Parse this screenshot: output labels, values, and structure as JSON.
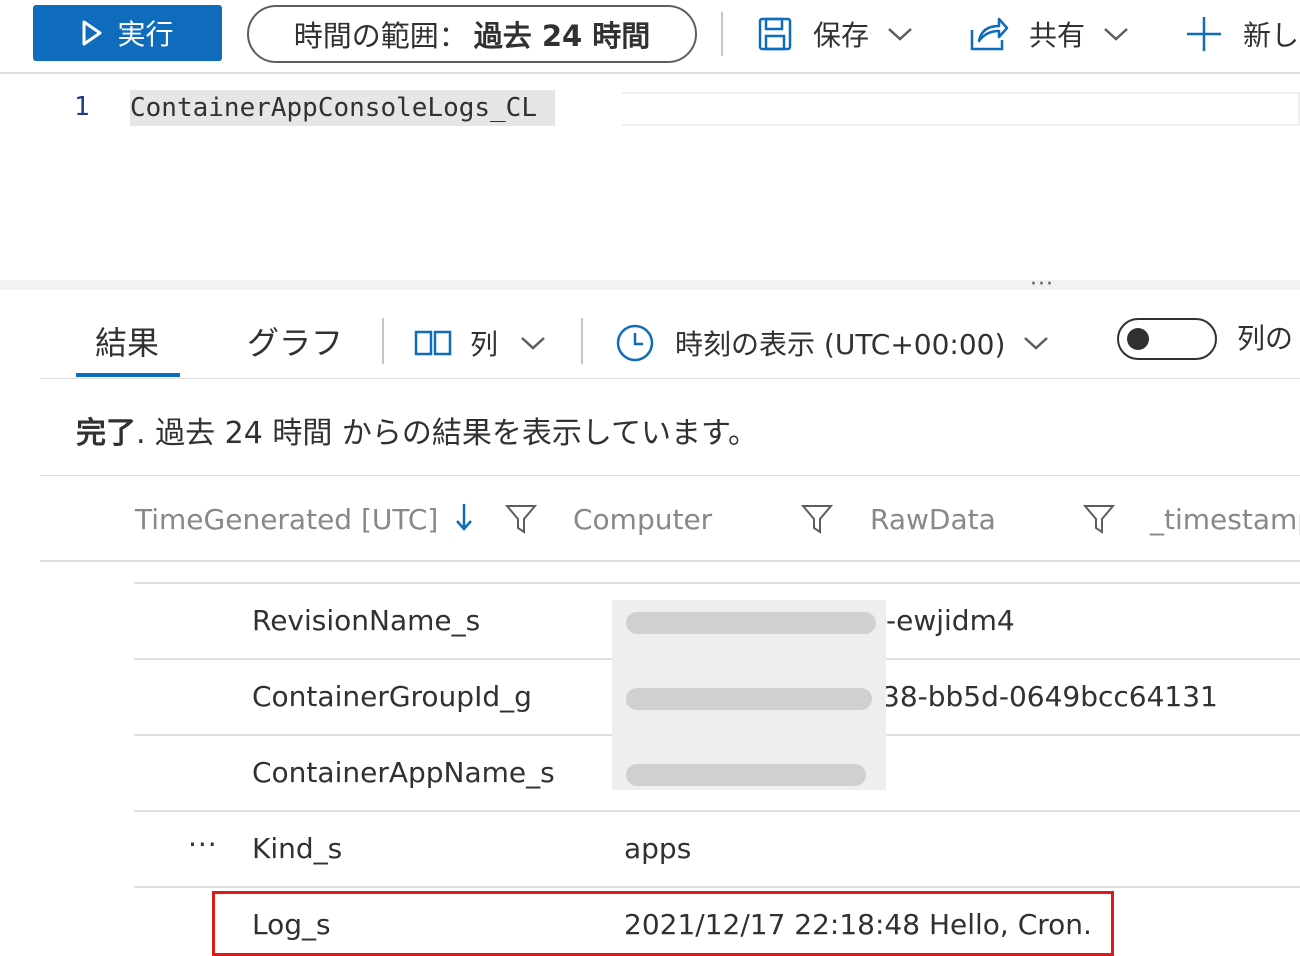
{
  "toolbar": {
    "run_label": "実行",
    "time_range_prefix": "時間の範囲：",
    "time_range_value": "過去 24 時間",
    "save_label": "保存",
    "share_label": "共有",
    "new_label": "新し"
  },
  "editor": {
    "line_number": "1",
    "query": "ContainerAppConsoleLogs_CL"
  },
  "results": {
    "tabs": [
      {
        "label": "結果",
        "active": true
      },
      {
        "label": "グラフ",
        "active": false
      }
    ],
    "columns_label": "列",
    "time_display_label": "時刻の表示 (UTC+00:00)",
    "toggle_label": "列の",
    "status_bold": "完了",
    "status_text": ". 過去 24 時間 からの結果を表示しています。",
    "headers": [
      "TimeGenerated [UTC]",
      "Computer",
      "RawData",
      "_timestamp"
    ]
  },
  "details": [
    {
      "key": "RevisionName_s",
      "value": "-ewjidm4",
      "redacted": true
    },
    {
      "key": "ContainerGroupId_g",
      "value": "38-bb5d-0649bcc64131",
      "redacted": true
    },
    {
      "key": "ContainerAppName_s",
      "value": "",
      "redacted": true
    },
    {
      "key": "Kind_s",
      "value": "apps",
      "redacted": false
    },
    {
      "key": "Log_s",
      "value": "2021/12/17 22:18:48 Hello, Cron.",
      "redacted": false,
      "highlighted": true
    }
  ],
  "colors": {
    "accent": "#0f6cbd",
    "highlight_border": "#e01919",
    "text": "#323130",
    "muted_header": "#8a8886"
  }
}
